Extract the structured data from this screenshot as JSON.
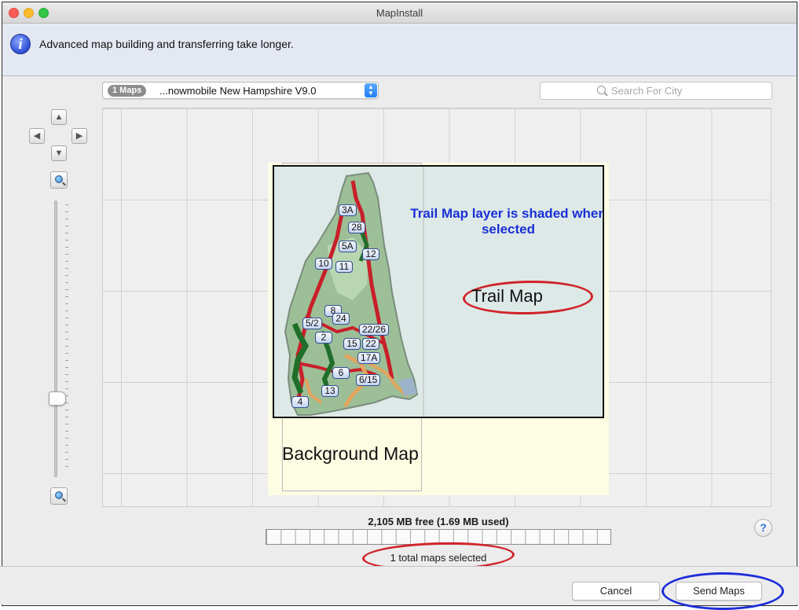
{
  "window": {
    "title": "MapInstall"
  },
  "info_bar": {
    "icon": "info-icon",
    "message": "Advanced map building and transferring take longer."
  },
  "map_selector": {
    "badge": "1 Maps",
    "selected_map": "...nowmobile New Hampshire V9.0",
    "icon": "up-down-chevron-icon"
  },
  "search": {
    "placeholder": "Search For City",
    "icon": "search-icon"
  },
  "navigation": {
    "pan_up": "▲",
    "pan_down": "▼",
    "pan_left": "◀",
    "pan_right": "▶",
    "zoom_in_icon": "zoom-in-icon",
    "zoom_out_icon": "zoom-out-icon"
  },
  "preview": {
    "callout": "Trail Map layer is shaded when selected",
    "trail_map_label": "Trail Map",
    "background_map_label": "Background Map",
    "route_labels": [
      "3A",
      "28",
      "5A",
      "12",
      "10",
      "11",
      "8",
      "24",
      "5/2",
      "22/26",
      "2",
      "15",
      "22",
      "17A",
      "6",
      "6/15",
      "13",
      "4"
    ]
  },
  "storage": {
    "label": "2,105 MB free (1.69 MB used)",
    "selected_text": "1 total maps selected"
  },
  "help": {
    "label": "?"
  },
  "buttons": {
    "cancel": "Cancel",
    "send": "Send Maps"
  },
  "colors": {
    "annotation_red": "#d0232a",
    "annotation_blue": "#1d2ed8",
    "callout_blue": "#1a2fd6",
    "trail_red": "#c8202a",
    "trail_green": "#1f6e2a",
    "trail_orange": "#e2a45e"
  }
}
